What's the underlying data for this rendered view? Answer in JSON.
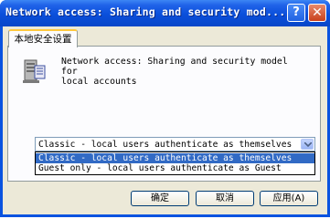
{
  "window": {
    "title": "Network access: Sharing and security mod..."
  },
  "titlebar": {
    "help_label": "?",
    "close_label": "✕"
  },
  "tabs": [
    {
      "label": "本地安全设置"
    }
  ],
  "policy": {
    "icon": "policy-server-icon",
    "description": "Network access: Sharing and security model for\nlocal accounts"
  },
  "dropdown": {
    "selected": "Classic - local users authenticate as themselves",
    "options": [
      "Classic - local users authenticate as themselves",
      "Guest only - local users authenticate as Guest"
    ],
    "highlighted_index": 0
  },
  "buttons": {
    "ok": "确定",
    "cancel": "取消",
    "apply": "应用(A)"
  },
  "colors": {
    "titlebar": "#0a4fdb",
    "selection": "#316ac5",
    "face": "#ece9d8",
    "tab_accent": "#ffc83c"
  }
}
